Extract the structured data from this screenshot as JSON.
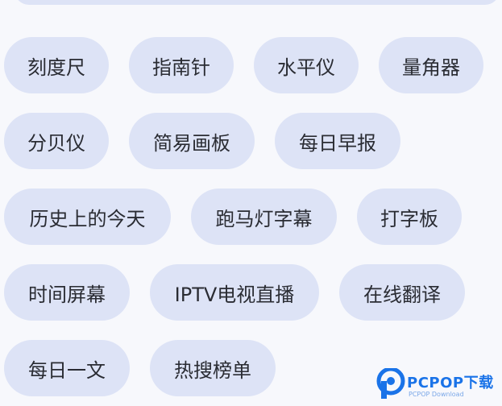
{
  "tools": {
    "row1": [
      "刻度尺",
      "指南针",
      "水平仪",
      "量角器"
    ],
    "row2": [
      "分贝仪",
      "简易画板",
      "每日早报"
    ],
    "row3": [
      "历史上的今天",
      "跑马灯字幕",
      "打字板"
    ],
    "row4": [
      "时间屏幕",
      "IPTV电视直播",
      "在线翻译"
    ],
    "row5": [
      "每日一文",
      "热搜榜单"
    ]
  },
  "watermark": {
    "brand": "PCPOP下载",
    "subtitle": "PCPOP Download"
  },
  "colors": {
    "chip_bg": "#dde3f6",
    "chip_text": "#2a2c33",
    "page_bg": "#f7f8fc",
    "watermark_blue": "#1a73e8"
  }
}
